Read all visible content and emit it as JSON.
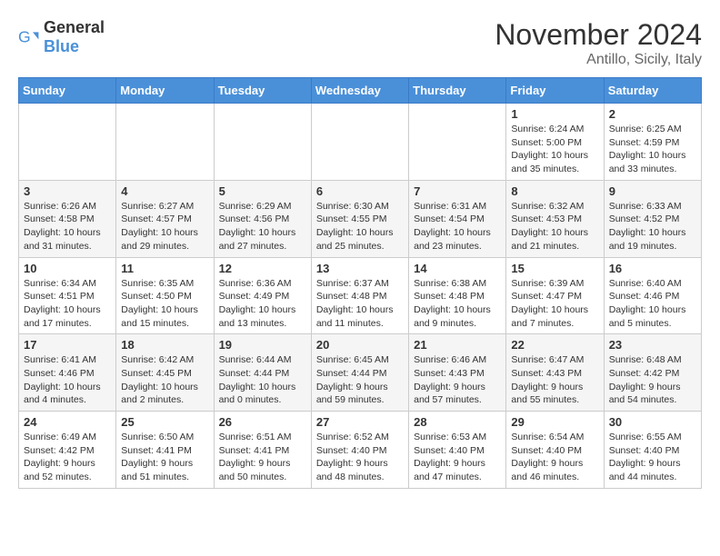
{
  "header": {
    "logo": {
      "text_general": "General",
      "text_blue": "Blue"
    },
    "month": "November 2024",
    "location": "Antillo, Sicily, Italy"
  },
  "weekdays": [
    "Sunday",
    "Monday",
    "Tuesday",
    "Wednesday",
    "Thursday",
    "Friday",
    "Saturday"
  ],
  "weeks": [
    {
      "days": [
        {
          "number": "",
          "info": ""
        },
        {
          "number": "",
          "info": ""
        },
        {
          "number": "",
          "info": ""
        },
        {
          "number": "",
          "info": ""
        },
        {
          "number": "",
          "info": ""
        },
        {
          "number": "1",
          "info": "Sunrise: 6:24 AM\nSunset: 5:00 PM\nDaylight: 10 hours and 35 minutes."
        },
        {
          "number": "2",
          "info": "Sunrise: 6:25 AM\nSunset: 4:59 PM\nDaylight: 10 hours and 33 minutes."
        }
      ]
    },
    {
      "days": [
        {
          "number": "3",
          "info": "Sunrise: 6:26 AM\nSunset: 4:58 PM\nDaylight: 10 hours and 31 minutes."
        },
        {
          "number": "4",
          "info": "Sunrise: 6:27 AM\nSunset: 4:57 PM\nDaylight: 10 hours and 29 minutes."
        },
        {
          "number": "5",
          "info": "Sunrise: 6:29 AM\nSunset: 4:56 PM\nDaylight: 10 hours and 27 minutes."
        },
        {
          "number": "6",
          "info": "Sunrise: 6:30 AM\nSunset: 4:55 PM\nDaylight: 10 hours and 25 minutes."
        },
        {
          "number": "7",
          "info": "Sunrise: 6:31 AM\nSunset: 4:54 PM\nDaylight: 10 hours and 23 minutes."
        },
        {
          "number": "8",
          "info": "Sunrise: 6:32 AM\nSunset: 4:53 PM\nDaylight: 10 hours and 21 minutes."
        },
        {
          "number": "9",
          "info": "Sunrise: 6:33 AM\nSunset: 4:52 PM\nDaylight: 10 hours and 19 minutes."
        }
      ]
    },
    {
      "days": [
        {
          "number": "10",
          "info": "Sunrise: 6:34 AM\nSunset: 4:51 PM\nDaylight: 10 hours and 17 minutes."
        },
        {
          "number": "11",
          "info": "Sunrise: 6:35 AM\nSunset: 4:50 PM\nDaylight: 10 hours and 15 minutes."
        },
        {
          "number": "12",
          "info": "Sunrise: 6:36 AM\nSunset: 4:49 PM\nDaylight: 10 hours and 13 minutes."
        },
        {
          "number": "13",
          "info": "Sunrise: 6:37 AM\nSunset: 4:48 PM\nDaylight: 10 hours and 11 minutes."
        },
        {
          "number": "14",
          "info": "Sunrise: 6:38 AM\nSunset: 4:48 PM\nDaylight: 10 hours and 9 minutes."
        },
        {
          "number": "15",
          "info": "Sunrise: 6:39 AM\nSunset: 4:47 PM\nDaylight: 10 hours and 7 minutes."
        },
        {
          "number": "16",
          "info": "Sunrise: 6:40 AM\nSunset: 4:46 PM\nDaylight: 10 hours and 5 minutes."
        }
      ]
    },
    {
      "days": [
        {
          "number": "17",
          "info": "Sunrise: 6:41 AM\nSunset: 4:46 PM\nDaylight: 10 hours and 4 minutes."
        },
        {
          "number": "18",
          "info": "Sunrise: 6:42 AM\nSunset: 4:45 PM\nDaylight: 10 hours and 2 minutes."
        },
        {
          "number": "19",
          "info": "Sunrise: 6:44 AM\nSunset: 4:44 PM\nDaylight: 10 hours and 0 minutes."
        },
        {
          "number": "20",
          "info": "Sunrise: 6:45 AM\nSunset: 4:44 PM\nDaylight: 9 hours and 59 minutes."
        },
        {
          "number": "21",
          "info": "Sunrise: 6:46 AM\nSunset: 4:43 PM\nDaylight: 9 hours and 57 minutes."
        },
        {
          "number": "22",
          "info": "Sunrise: 6:47 AM\nSunset: 4:43 PM\nDaylight: 9 hours and 55 minutes."
        },
        {
          "number": "23",
          "info": "Sunrise: 6:48 AM\nSunset: 4:42 PM\nDaylight: 9 hours and 54 minutes."
        }
      ]
    },
    {
      "days": [
        {
          "number": "24",
          "info": "Sunrise: 6:49 AM\nSunset: 4:42 PM\nDaylight: 9 hours and 52 minutes."
        },
        {
          "number": "25",
          "info": "Sunrise: 6:50 AM\nSunset: 4:41 PM\nDaylight: 9 hours and 51 minutes."
        },
        {
          "number": "26",
          "info": "Sunrise: 6:51 AM\nSunset: 4:41 PM\nDaylight: 9 hours and 50 minutes."
        },
        {
          "number": "27",
          "info": "Sunrise: 6:52 AM\nSunset: 4:40 PM\nDaylight: 9 hours and 48 minutes."
        },
        {
          "number": "28",
          "info": "Sunrise: 6:53 AM\nSunset: 4:40 PM\nDaylight: 9 hours and 47 minutes."
        },
        {
          "number": "29",
          "info": "Sunrise: 6:54 AM\nSunset: 4:40 PM\nDaylight: 9 hours and 46 minutes."
        },
        {
          "number": "30",
          "info": "Sunrise: 6:55 AM\nSunset: 4:40 PM\nDaylight: 9 hours and 44 minutes."
        }
      ]
    }
  ]
}
